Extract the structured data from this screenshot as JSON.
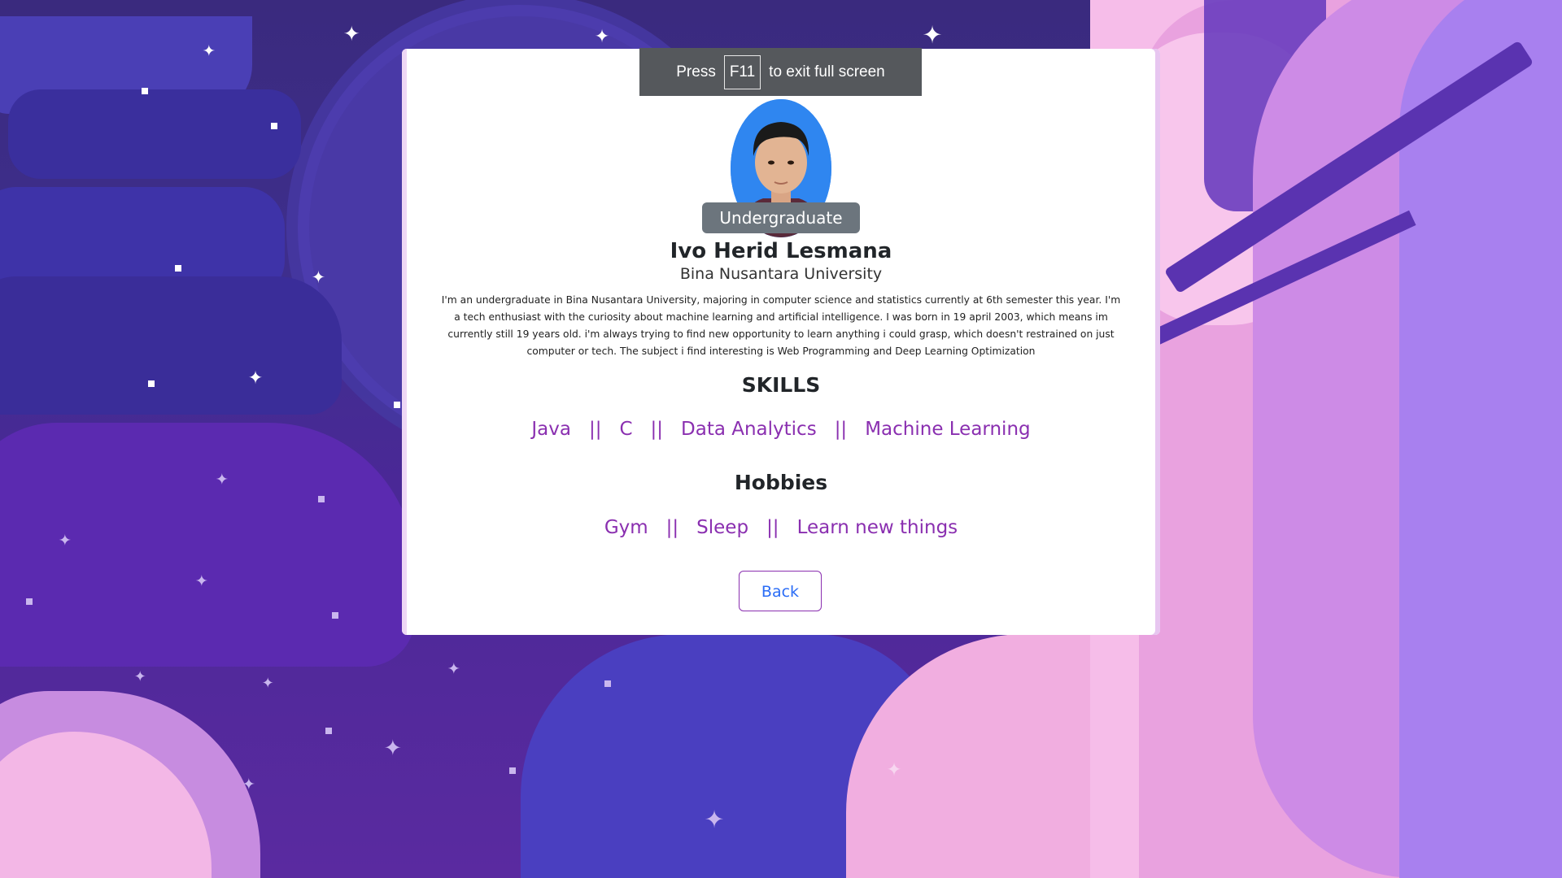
{
  "toast": {
    "prefix": "Press",
    "key": "F11",
    "suffix": "to exit full screen"
  },
  "profile": {
    "status_badge": "Undergraduate",
    "name": "Ivo Herid Lesmana",
    "university": "Bina Nusantara University",
    "bio": "I'm an undergraduate in Bina Nusantara University, majoring in computer science and statistics currently at 6th semester this year. I'm a tech enthusiast with the curiosity about machine learning and artificial intelligence. I was born in 19 april 2003, which means im currently still 19 years old. i'm always trying to find new opportunity to learn anything i could grasp, which doesn't restrained on just computer or tech. The subject i find interesting is Web Programming and Deep Learning Optimization"
  },
  "skills": {
    "title": "SKILLS",
    "separator": "||",
    "items": [
      "Java",
      "C",
      "Data Analytics",
      "Machine Learning"
    ]
  },
  "hobbies": {
    "title": "Hobbies",
    "separator": "||",
    "items": [
      "Gym",
      "Sleep",
      "Learn new things"
    ]
  },
  "back_button": {
    "label": "Back"
  },
  "colors": {
    "accent": "#8a2fb0",
    "badge": "#6c757d",
    "button_text": "#2a6cf6",
    "toast_bg": "#55585c"
  }
}
